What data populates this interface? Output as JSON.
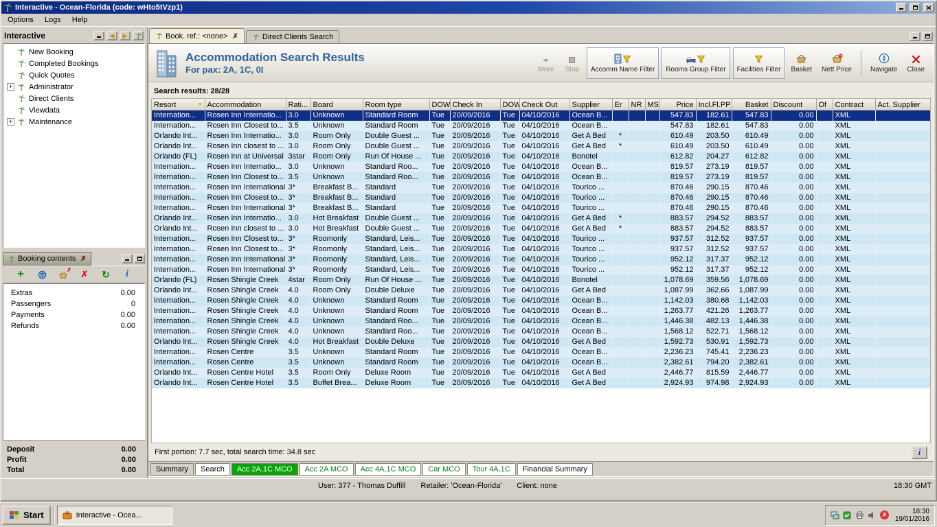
{
  "window": {
    "title": "Interactive - Ocean-Florida (code: wHto5tVzp1)",
    "menus": [
      "Options",
      "Logs",
      "Help"
    ]
  },
  "sidebar": {
    "title": "Interactive",
    "items": [
      {
        "label": "New Booking"
      },
      {
        "label": "Completed Bookings"
      },
      {
        "label": "Quick Quotes"
      },
      {
        "label": "Administrator",
        "cls": "has-children"
      },
      {
        "label": "Direct Clients"
      },
      {
        "label": "Viewdata"
      },
      {
        "label": "Maintenance",
        "cls": "has-children"
      }
    ]
  },
  "booking_contents": {
    "title": "Booking contents",
    "rows": [
      {
        "label": "Extras",
        "value": "0.00"
      },
      {
        "label": "Passengers",
        "value": "0"
      },
      {
        "label": "Payments",
        "value": "0.00"
      },
      {
        "label": "Refunds",
        "value": "0.00"
      }
    ],
    "totals": [
      {
        "label": "Deposit",
        "value": "0.00"
      },
      {
        "label": "Profit",
        "value": "0.00"
      },
      {
        "label": "Total",
        "value": "0.00"
      }
    ]
  },
  "tabs": [
    {
      "label": "Book. ref.: <none>",
      "cls": "active"
    },
    {
      "label": "Direct Clients Search"
    }
  ],
  "header": {
    "title": "Accommodation Search Results",
    "subtitle": "For pax: 2A, 1C, 0I"
  },
  "toolbar": {
    "buttons": [
      {
        "label": "More",
        "icon": "chevron-down-icon",
        "disabled": true
      },
      {
        "label": "Stop",
        "icon": "stop-icon",
        "disabled": true
      },
      {
        "label": "Accomm Name Filter",
        "icon": "hotel-filter-icon"
      },
      {
        "label": "Rooms Group Filter",
        "icon": "rooms-filter-icon"
      },
      {
        "label": "Facilities Filter",
        "icon": "funnel-icon"
      },
      {
        "label": "Basket",
        "icon": "basket-icon"
      },
      {
        "label": "Nett Price",
        "icon": "nett-price-icon"
      },
      {
        "label": "Navigate",
        "icon": "compass-icon"
      },
      {
        "label": "Close",
        "icon": "close-icon"
      }
    ]
  },
  "results": {
    "summary": "Search results: 28/28",
    "columns": [
      "Resort",
      "Accommodation",
      "Rati...",
      "Board",
      "Room type",
      "DOW",
      "Check In",
      "DOW",
      "Check Out",
      "Supplier",
      "Er",
      "NR",
      "MS",
      "Price",
      "Incl.Fl.PP",
      "Basket",
      "Discount",
      "Of",
      "Contract",
      "Act. Supplier"
    ],
    "row_defaults": {
      "dow1": "Tue",
      "checkin": "20/09/2016",
      "dow2": "Tue",
      "checkout": "04/10/2016",
      "discount": "0.00",
      "contract": "XML"
    },
    "rows": [
      {
        "cls": "selected",
        "resort": "Internation...",
        "accom": "Rosen Inn Internatio...",
        "rating": "3.0",
        "board": "Unknown",
        "room": "Standard Room",
        "supplier": "Ocean B...",
        "price": "547.83",
        "inclpp": "182.61",
        "basket": "547.83"
      },
      {
        "resort": "Internation...",
        "accom": "Rosen Inn Closest to...",
        "rating": "3.5",
        "board": "Unknown",
        "room": "Standard Room",
        "supplier": "Ocean B...",
        "price": "547.83",
        "inclpp": "182.61",
        "basket": "547.83"
      },
      {
        "resort": "Orlando Int...",
        "accom": "Rosen Inn Internatio...",
        "rating": "3.0",
        "board": "Room Only",
        "room": "Double Guest ...",
        "supplier": "Get A Bed",
        "er": "*",
        "price": "610.49",
        "inclpp": "203.50",
        "basket": "610.49"
      },
      {
        "resort": "Orlando Int...",
        "accom": "Rosen Inn closest to ...",
        "rating": "3.0",
        "board": "Room Only",
        "room": "Double Guest ...",
        "supplier": "Get A Bed",
        "er": "*",
        "price": "610.49",
        "inclpp": "203.50",
        "basket": "610.49"
      },
      {
        "resort": "Orlando (FL)",
        "accom": "Rosen Inn at Universal",
        "rating": "3star",
        "board": "Room Only",
        "room": "Run Of House ...",
        "supplier": "Bonotel",
        "price": "612.82",
        "inclpp": "204.27",
        "basket": "612.82"
      },
      {
        "resort": "Internation...",
        "accom": "Rosen Inn Internatio...",
        "rating": "3.0",
        "board": "Unknown",
        "room": "Standard Roo...",
        "supplier": "Ocean B...",
        "price": "819.57",
        "inclpp": "273.19",
        "basket": "819.57"
      },
      {
        "resort": "Internation...",
        "accom": "Rosen Inn Closest to...",
        "rating": "3.5",
        "board": "Unknown",
        "room": "Standard Roo...",
        "supplier": "Ocean B...",
        "price": "819.57",
        "inclpp": "273.19",
        "basket": "819.57"
      },
      {
        "resort": "Internation...",
        "accom": "Rosen Inn International",
        "rating": "3*",
        "board": "Breakfast B...",
        "room": "Standard",
        "supplier": "Tourico ...",
        "price": "870.46",
        "inclpp": "290.15",
        "basket": "870.46"
      },
      {
        "resort": "Internation...",
        "accom": "Rosen Inn Closest to...",
        "rating": "3*",
        "board": "Breakfast B...",
        "room": "Standard",
        "supplier": "Tourico ...",
        "price": "870.46",
        "inclpp": "290.15",
        "basket": "870.46"
      },
      {
        "resort": "Internation...",
        "accom": "Rosen Inn International",
        "rating": "3*",
        "board": "Breakfast B...",
        "room": "Standard",
        "supplier": "Tourico ...",
        "price": "870.46",
        "inclpp": "290.15",
        "basket": "870.46"
      },
      {
        "resort": "Orlando Int...",
        "accom": "Rosen Inn Internatio...",
        "rating": "3.0",
        "board": "Hot Breakfast",
        "room": "Double Guest ...",
        "supplier": "Get A Bed",
        "er": "*",
        "price": "883.57",
        "inclpp": "294.52",
        "basket": "883.57"
      },
      {
        "resort": "Orlando Int...",
        "accom": "Rosen Inn closest to ...",
        "rating": "3.0",
        "board": "Hot Breakfast",
        "room": "Double Guest ...",
        "supplier": "Get A Bed",
        "er": "*",
        "price": "883.57",
        "inclpp": "294.52",
        "basket": "883.57"
      },
      {
        "resort": "Internation...",
        "accom": "Rosen Inn Closest to...",
        "rating": "3*",
        "board": "Roomonly",
        "room": "Standard, Leis...",
        "supplier": "Tourico ...",
        "price": "937.57",
        "inclpp": "312.52",
        "basket": "937.57"
      },
      {
        "resort": "Internation...",
        "accom": "Rosen Inn Closest to...",
        "rating": "3*",
        "board": "Roomonly",
        "room": "Standard, Leis...",
        "supplier": "Tourico ...",
        "price": "937.57",
        "inclpp": "312.52",
        "basket": "937.57"
      },
      {
        "resort": "Internation...",
        "accom": "Rosen Inn International",
        "rating": "3*",
        "board": "Roomonly",
        "room": "Standard, Leis...",
        "supplier": "Tourico ...",
        "price": "952.12",
        "inclpp": "317.37",
        "basket": "952.12"
      },
      {
        "resort": "Internation...",
        "accom": "Rosen Inn International",
        "rating": "3*",
        "board": "Roomonly",
        "room": "Standard, Leis...",
        "supplier": "Tourico ...",
        "price": "952.12",
        "inclpp": "317.37",
        "basket": "952.12"
      },
      {
        "resort": "Orlando (FL)",
        "accom": "Rosen Shingle Creek",
        "rating": "4star",
        "board": "Room Only",
        "room": "Run Of House ...",
        "supplier": "Bonotel",
        "price": "1,078.69",
        "inclpp": "359.56",
        "basket": "1,078.69"
      },
      {
        "resort": "Orlando Int...",
        "accom": "Rosen Shingle Creek",
        "rating": "4.0",
        "board": "Room Only",
        "room": "Double Deluxe",
        "supplier": "Get A Bed",
        "price": "1,087.99",
        "inclpp": "362.66",
        "basket": "1,087.99"
      },
      {
        "resort": "Internation...",
        "accom": "Rosen Shingle Creek",
        "rating": "4.0",
        "board": "Unknown",
        "room": "Standard Room",
        "supplier": "Ocean B...",
        "price": "1,142.03",
        "inclpp": "380.68",
        "basket": "1,142.03"
      },
      {
        "resort": "Internation...",
        "accom": "Rosen Shingle Creek",
        "rating": "4.0",
        "board": "Unknown",
        "room": "Standard Room",
        "supplier": "Ocean B...",
        "price": "1,263.77",
        "inclpp": "421.26",
        "basket": "1,263.77"
      },
      {
        "resort": "Internation...",
        "accom": "Rosen Shingle Creek",
        "rating": "4.0",
        "board": "Unknown",
        "room": "Standard Roo...",
        "supplier": "Ocean B...",
        "price": "1,446.38",
        "inclpp": "482.13",
        "basket": "1,446.38"
      },
      {
        "resort": "Internation...",
        "accom": "Rosen Shingle Creek",
        "rating": "4.0",
        "board": "Unknown",
        "room": "Standard Roo...",
        "supplier": "Ocean B...",
        "price": "1,568.12",
        "inclpp": "522.71",
        "basket": "1,568.12"
      },
      {
        "resort": "Orlando Int...",
        "accom": "Rosen Shingle Creek",
        "rating": "4.0",
        "board": "Hot Breakfast",
        "room": "Double Deluxe",
        "supplier": "Get A Bed",
        "price": "1,592.73",
        "inclpp": "530.91",
        "basket": "1,592.73"
      },
      {
        "resort": "Internation...",
        "accom": "Rosen Centre",
        "rating": "3.5",
        "board": "Unknown",
        "room": "Standard Room",
        "supplier": "Ocean B...",
        "price": "2,236.23",
        "inclpp": "745.41",
        "basket": "2,236.23"
      },
      {
        "resort": "Internation...",
        "accom": "Rosen Centre",
        "rating": "3.5",
        "board": "Unknown",
        "room": "Standard Room",
        "supplier": "Ocean B...",
        "price": "2,382.61",
        "inclpp": "794.20",
        "basket": "2,382.61"
      },
      {
        "resort": "Orlando Int...",
        "accom": "Rosen Centre Hotel",
        "rating": "3.5",
        "board": "Room Only",
        "room": "Deluxe Room",
        "supplier": "Get A Bed",
        "price": "2,446.77",
        "inclpp": "815.59",
        "basket": "2,446.77"
      },
      {
        "resort": "Orlando Int...",
        "accom": "Rosen Centre Hotel",
        "rating": "3.5",
        "board": "Buffet Brea...",
        "room": "Deluxe Room",
        "supplier": "Get A Bed",
        "price": "2,924.93",
        "inclpp": "974.98",
        "basket": "2,924.93"
      }
    ]
  },
  "status": {
    "search_time": "First portion: 7.7 sec, total search time: 34.8 sec"
  },
  "bottom_tabs": [
    {
      "label": "Summary"
    },
    {
      "label": "Search",
      "cls": "white"
    },
    {
      "label": "Acc 2A,1C MCO",
      "cls": "green-active"
    },
    {
      "label": "Acc 2A MCO",
      "cls": "green"
    },
    {
      "label": "Acc 4A,1C MCO",
      "cls": "green"
    },
    {
      "label": "Car MCO",
      "cls": "green"
    },
    {
      "label": "Tour 4A,1C",
      "cls": "green"
    },
    {
      "label": "Financial Summary",
      "cls": "white"
    }
  ],
  "status_bar": {
    "user": "User: 377 - Thomas Duffill",
    "retailer": "Retailer: 'Ocean-Florida'",
    "client": "Client: none",
    "time": "18:30 GMT"
  },
  "taskbar": {
    "start_label": "Start",
    "task_label": "Interactive - Ocea...",
    "clock_time": "18:30",
    "clock_date": "19/01/2016"
  },
  "colors": {
    "titlebar_blue": "#0b2a80",
    "accent_blue": "#2f6399",
    "selected_row": "#0d2f86",
    "active_tab_green": "#0aa40a",
    "row_light": "#dcedf8",
    "row_dark": "#cfe6f4"
  }
}
